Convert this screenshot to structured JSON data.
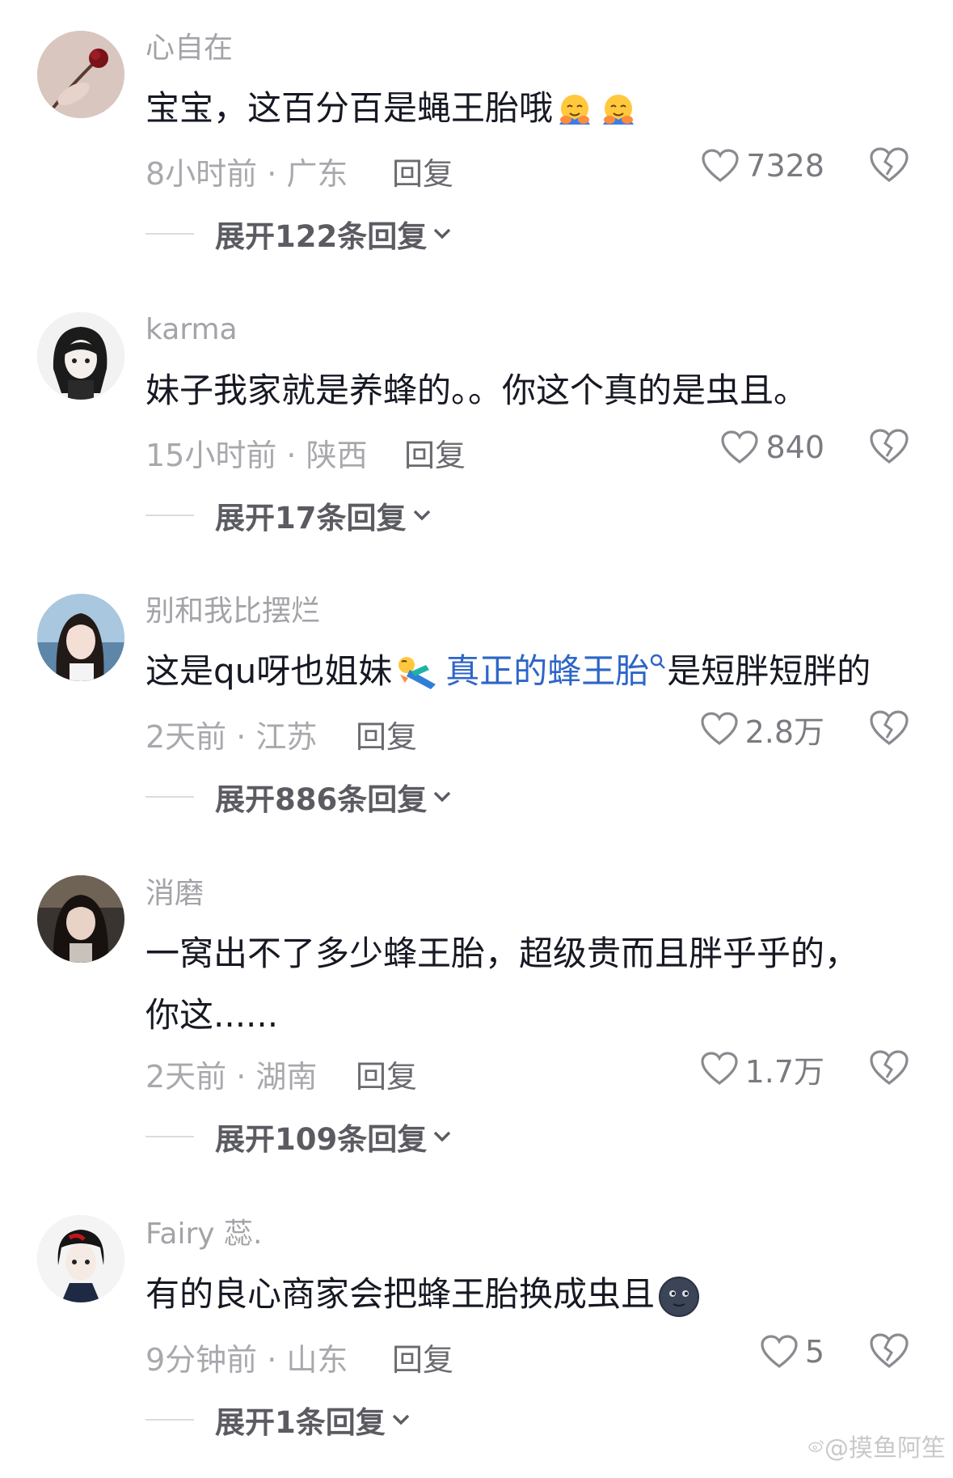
{
  "comments": [
    {
      "username": "心自在",
      "text_before": "宝宝，这百分百是蝇王胎哦",
      "meta": "8小时前 · 广东",
      "reply_label": "回复",
      "likes": "7328",
      "expand_label": "展开122条回复"
    },
    {
      "username": "karma",
      "text": "妹子我家就是养蜂的。。你这个真的是虫且。",
      "meta": "15小时前 · 陕西",
      "reply_label": "回复",
      "likes": "840",
      "expand_label": "展开17条回复"
    },
    {
      "username": "别和我比摆烂",
      "text_before": "这是qu呀也姐妹",
      "highlight": "真正的蜂王胎",
      "text_after": "是短胖短胖的",
      "meta": "2天前 · 江苏",
      "reply_label": "回复",
      "likes": "2.8万",
      "expand_label": "展开886条回复"
    },
    {
      "username": "消磨",
      "text_line1": "一窝出不了多少蜂王胎，超级贵而且胖乎乎的，",
      "text_line2": "你这......",
      "meta": "2天前 · 湖南",
      "reply_label": "回复",
      "likes": "1.7万",
      "expand_label": "展开109条回复"
    },
    {
      "username": "Fairy 蕊.",
      "text_before": "有的良心商家会把蜂王胎换成虫且",
      "meta": "9分钟前 · 山东",
      "reply_label": "回复",
      "likes": "5",
      "expand_label": "展开1条回复"
    }
  ],
  "watermark": "@摸鱼阿笙",
  "colors": {
    "username": "#a3a3a8",
    "content": "#161823",
    "highlight": "#2e66c8",
    "meta": "#a8a8ad"
  }
}
